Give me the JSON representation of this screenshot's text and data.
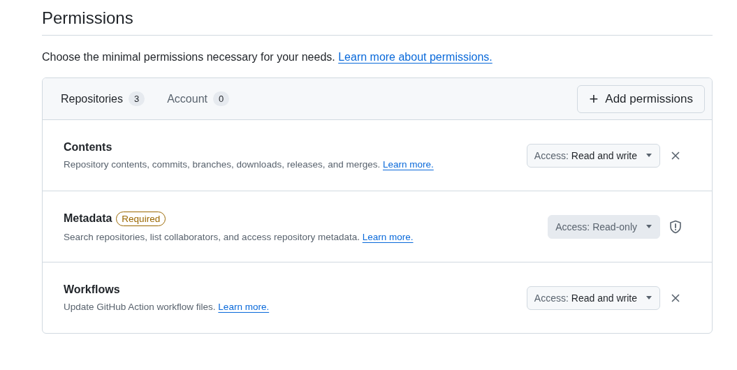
{
  "heading": "Permissions",
  "intro": {
    "text": "Choose the minimal permissions necessary for your needs.",
    "link": "Learn more about permissions."
  },
  "tabs": [
    {
      "label": "Repositories",
      "count": "3",
      "selected": true
    },
    {
      "label": "Account",
      "count": "0",
      "selected": false
    }
  ],
  "add_button": {
    "icon": "+",
    "label": "Add permissions"
  },
  "permissions": [
    {
      "name": "Contents",
      "description": "Repository contents, commits, branches, downloads, releases, and merges.",
      "link": "Learn more.",
      "access_prefix": "Access:",
      "access": "Read and write",
      "disabled": false,
      "kind": "removable"
    },
    {
      "name": "Metadata",
      "badge": "Required",
      "description": "Search repositories, list collaborators, and access repository metadata.",
      "link": "Learn more.",
      "access_prefix": "Access:",
      "access": "Read-only",
      "disabled": true,
      "kind": "required"
    },
    {
      "name": "Workflows",
      "description": "Update GitHub Action workflow files.",
      "link": "Learn more.",
      "access_prefix": "Access:",
      "access": "Read and write",
      "disabled": false,
      "kind": "removable"
    }
  ]
}
